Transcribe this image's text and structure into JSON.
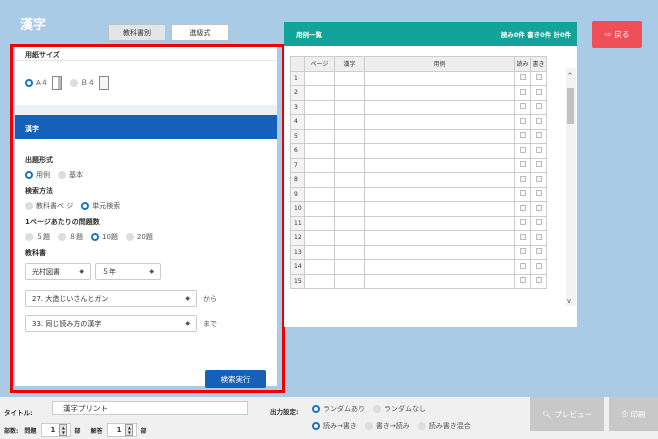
{
  "app": {
    "title": "漢字"
  },
  "tabs": [
    {
      "label": "教科書別"
    },
    {
      "label": "進級式"
    }
  ],
  "back_button": {
    "label": "戻る"
  },
  "paper": {
    "header": "用紙サイズ",
    "a4": "A４",
    "b4": "Ｂ４"
  },
  "kanji": {
    "header": "漢字",
    "format_label": "出題形式",
    "format_opt1": "用例",
    "format_opt2": "基本",
    "method_label": "検索方法",
    "method_opt1": "教科書ペ ジ",
    "method_opt2": "単元検索",
    "count_label": "1ページあたりの問題数",
    "count_opts": [
      "５題",
      "８題",
      "10題",
      "20題"
    ],
    "book_label": "教科書",
    "publisher": "光村図書",
    "grade": "５年",
    "from_unit": "27. 大造じいさんとガン",
    "from_suffix": "から",
    "to_unit": "33. 同じ読み方の漢字",
    "to_suffix": "まで",
    "search_button": "検索実行"
  },
  "examples": {
    "header": "用例一覧",
    "summary": "読み0件 書き0件 計0件",
    "columns": [
      "ページ",
      "漢字",
      "用例",
      "読み",
      "書き"
    ],
    "rows": [
      "1",
      "2",
      "3",
      "4",
      "5",
      "6",
      "7",
      "8",
      "9",
      "10",
      "11",
      "12",
      "13",
      "14",
      "15"
    ]
  },
  "bottom": {
    "title_label": "タイトル:",
    "title_value": "漢字プリント",
    "copies_label": "部数:",
    "question_label": "問題",
    "question_value": "1",
    "unit1": "部",
    "answer_label": "解答",
    "answer_value": "1",
    "unit2": "部",
    "output_label": "出力設定:",
    "random_on": "ランダムあり",
    "random_off": "ランダムなし",
    "mode1": "読み→書き",
    "mode2": "書き→読み",
    "mode3": "読み書き混合",
    "preview": "プレビュー",
    "print": "印刷"
  }
}
